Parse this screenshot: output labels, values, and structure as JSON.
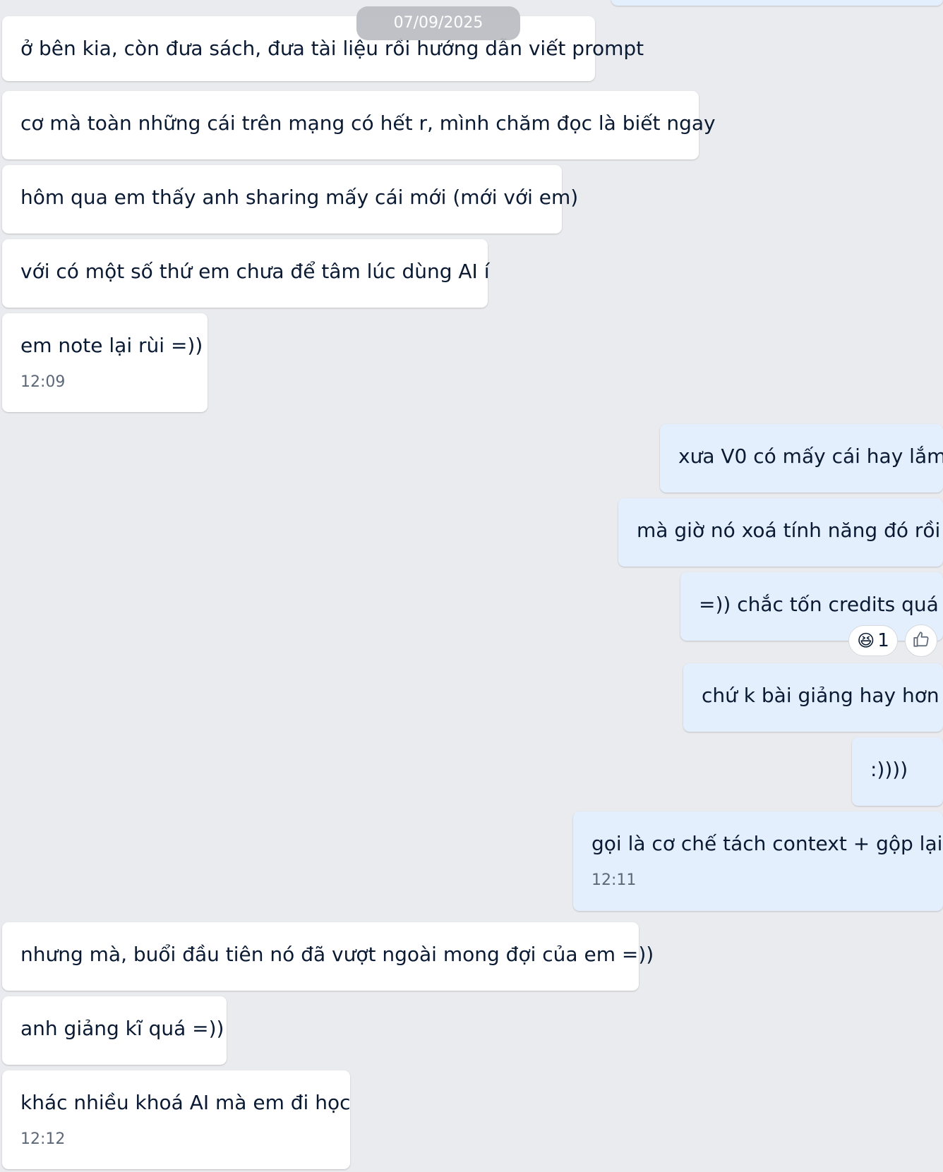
{
  "date_separator": "07/09/2025",
  "messages": [
    {
      "text": "ở bên kia, còn đưa sách, đưa tài liệu rồi hướng dẫn viết prompt",
      "direction": "incoming"
    },
    {
      "text": "cơ mà toàn những cái trên mạng có hết r, mình chăm đọc là biết ngay",
      "direction": "incoming"
    },
    {
      "text": "hôm qua em thấy anh sharing mấy cái mới (mới với em)",
      "direction": "incoming"
    },
    {
      "text": "với có một số thứ em chưa để tâm lúc dùng AI í",
      "direction": "incoming"
    },
    {
      "text": "em note lại rùi =))",
      "direction": "incoming",
      "time": "12:09"
    },
    {
      "text": "xưa V0 có mấy cái hay lắm",
      "direction": "outgoing"
    },
    {
      "text": "mà giờ nó xoá tính năng đó rồi",
      "direction": "outgoing"
    },
    {
      "text": "=)) chắc tốn credits quá",
      "direction": "outgoing",
      "reaction": {
        "emoji": "😆",
        "count": "1",
        "icon": "laughing-emoji-icon"
      }
    },
    {
      "text": "chứ k bài giảng hay hơn",
      "direction": "outgoing"
    },
    {
      "text": ":))))",
      "direction": "outgoing"
    },
    {
      "text": "gọi là cơ chế tách context + gộp lại",
      "direction": "outgoing",
      "time": "12:11"
    },
    {
      "text": "nhưng mà, buổi đầu tiên nó đã vượt ngoài mong đợi của em =))",
      "direction": "incoming"
    },
    {
      "text": "anh giảng kĩ quá =))",
      "direction": "incoming"
    },
    {
      "text": "khác nhiều khoá AI mà em đi học",
      "direction": "incoming",
      "time": "12:12"
    }
  ],
  "like_button": {
    "icon": "thumbs-up-icon"
  },
  "colors": {
    "background": "#eaebee",
    "incoming_bubble": "#ffffff",
    "outgoing_bubble": "#e4effe",
    "text": "#0a1a33",
    "timestamp": "#5c6778"
  }
}
